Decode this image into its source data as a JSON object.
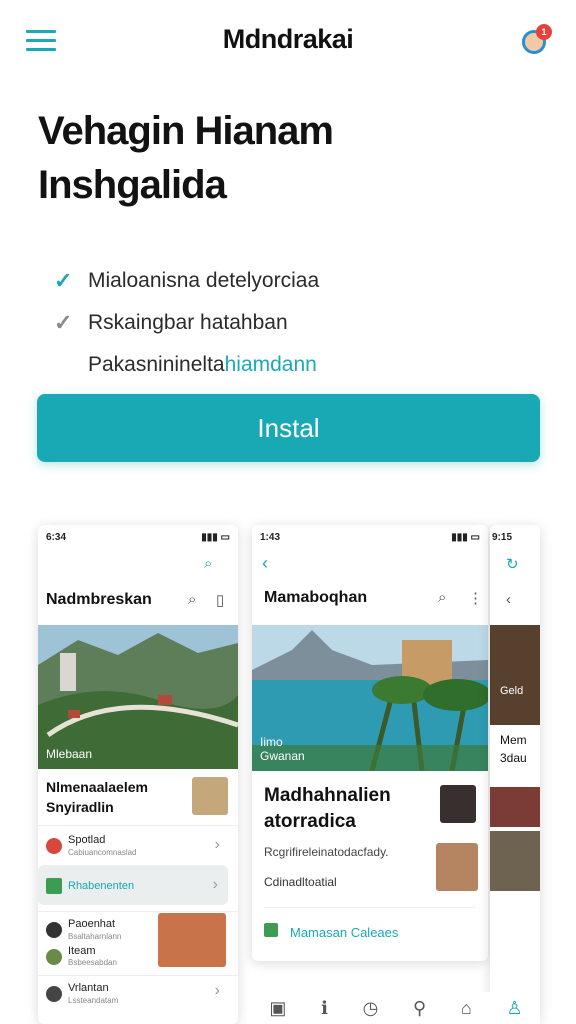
{
  "header": {
    "title": "Mdndrakai",
    "avatar_badge": "1"
  },
  "hero": {
    "title_line1": "Vehagin Hianam",
    "title_line2": "Inshgalida",
    "features": [
      {
        "text": "Mialoanisna detelyorciaa",
        "accent": ""
      },
      {
        "text": "Rskaingbar hatahban",
        "accent": ""
      },
      {
        "text": "Pakasnininelta ",
        "accent": "hiamdann"
      }
    ],
    "install_label": "Instal"
  },
  "shot1": {
    "status_time": "6:34",
    "title": "Nadmbreskan",
    "photo_caption": "Mlebaan",
    "section_title_l1": "Nlmenaalaelem",
    "section_title_l2": "Snyiradlin",
    "rows": [
      {
        "label": "Spotlad",
        "sub": "Cabiuancomnaslad"
      },
      {
        "label": "Rhabenenten",
        "sub": ""
      },
      {
        "label": "Paoenhat",
        "sub": "Bsaltaharnlann"
      },
      {
        "label": "Iteam",
        "sub": "Bsbeesabdan"
      },
      {
        "label": "Vrlantan",
        "sub": "Lssteandatam"
      }
    ]
  },
  "shot2": {
    "status_time": "1:43",
    "title": "Mamaboqhan",
    "photo_caption_l1": "Iimo",
    "photo_caption_l2": "Gwanan",
    "heading_l1": "Madhahnalien",
    "heading_l2": "atorradica",
    "desc": "Rcgrifireleinatodacfady.",
    "sub": "Cdinadltoatial",
    "link": "Mamasan Caleaes"
  },
  "shot3": {
    "status_time": "9:15",
    "snippet_l1": "Mem",
    "snippet_l2": "3dau",
    "snippet_l3": "Geld"
  },
  "icons": {
    "menu": "hamburger-icon",
    "search": "search-icon",
    "back": "chevron-left-icon",
    "check": "check-icon"
  },
  "colors": {
    "accent": "#18a9b4",
    "badge": "#e8413c"
  }
}
